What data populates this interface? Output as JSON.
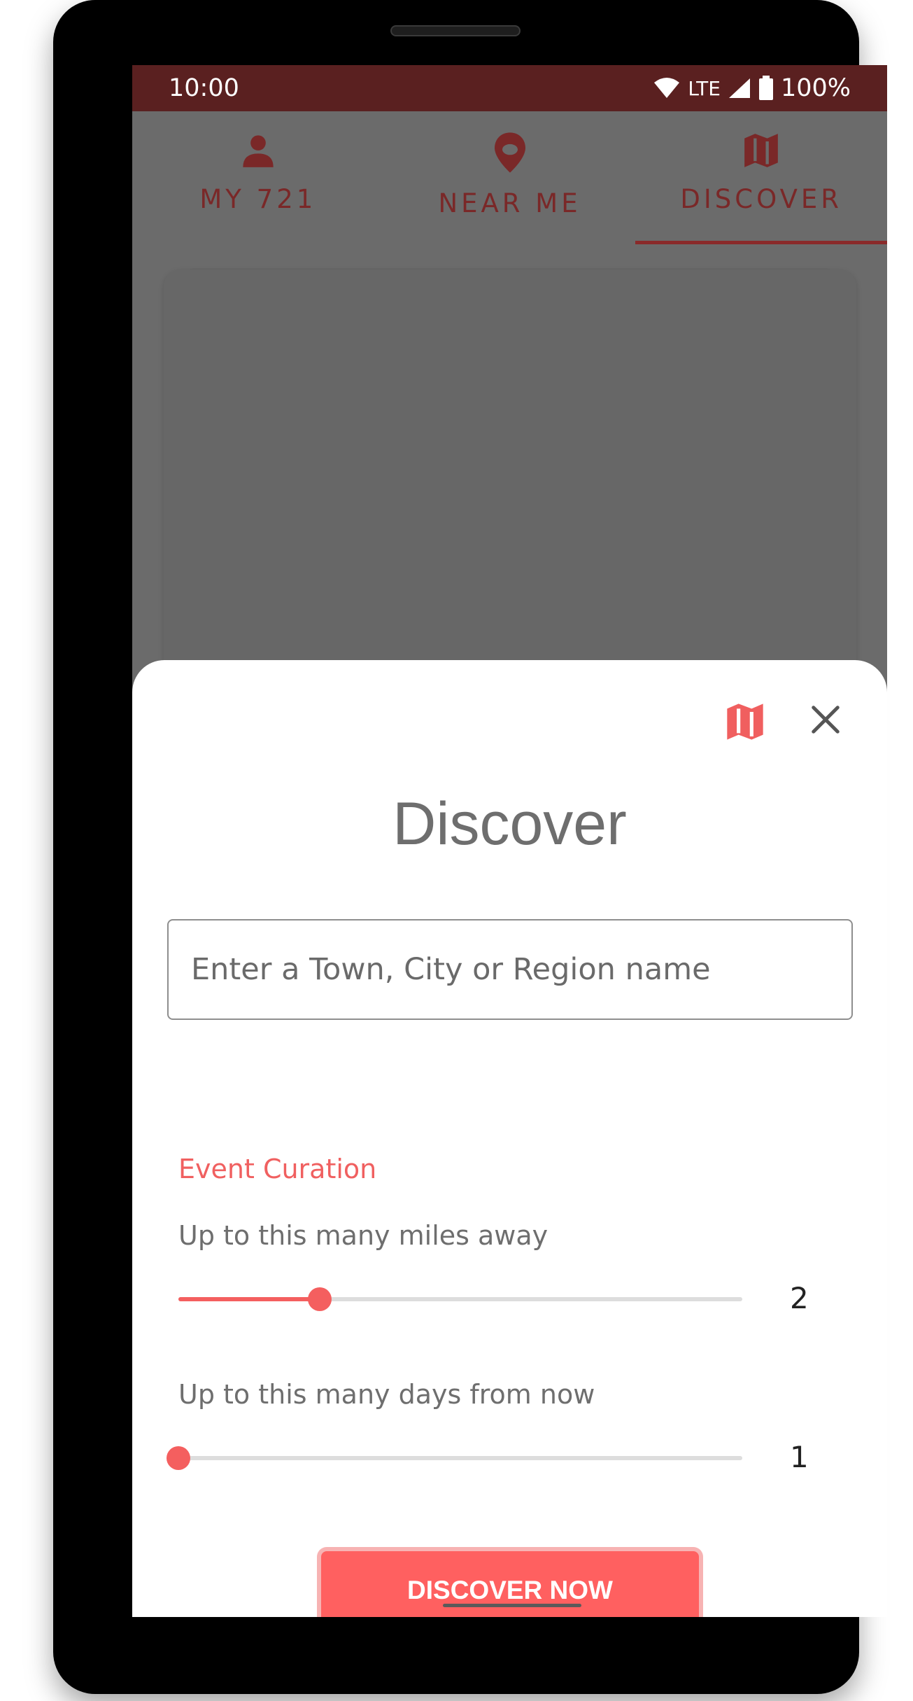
{
  "status_bar": {
    "time": "10:00",
    "network": "LTE",
    "battery": "100%"
  },
  "tabs": [
    {
      "label": "MY 721",
      "icon": "person-icon",
      "active": false
    },
    {
      "label": "NEAR ME",
      "icon": "location-pin-icon",
      "active": false
    },
    {
      "label": "DISCOVER",
      "icon": "map-icon",
      "active": true
    }
  ],
  "sheet": {
    "title": "Discover",
    "search": {
      "placeholder": "Enter a Town, City or Region name",
      "value": ""
    },
    "section_label": "Event Curation",
    "sliders": [
      {
        "label": "Up to this many miles away",
        "value": "2",
        "fraction": 0.25
      },
      {
        "label": "Up to this many days from now",
        "value": "1",
        "fraction": 0.0
      }
    ],
    "cta_label": "DISCOVER NOW"
  },
  "colors": {
    "accent": "#ff6060",
    "status_bar": "#5a2020",
    "tab_text": "#7a2828",
    "scrim": "#6b6b6b"
  }
}
